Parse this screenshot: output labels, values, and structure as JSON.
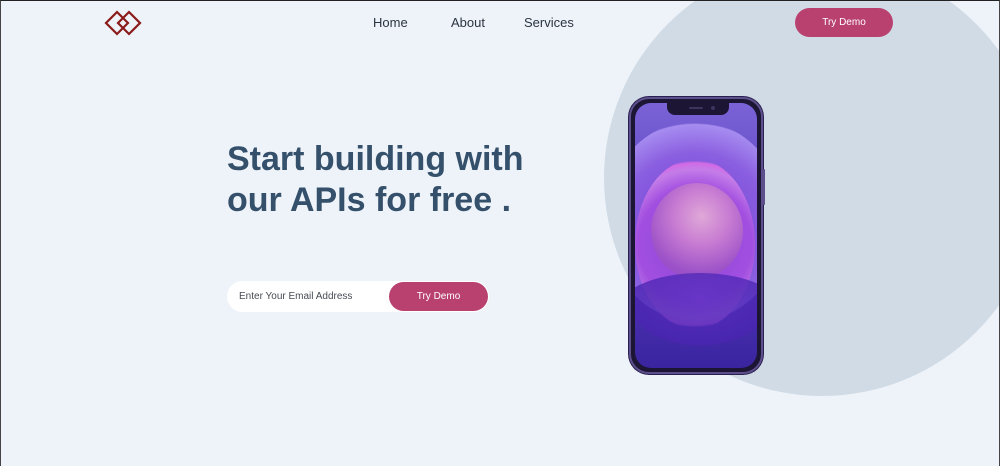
{
  "nav": {
    "links": [
      {
        "label": "Home"
      },
      {
        "label": "About"
      },
      {
        "label": "Services"
      }
    ],
    "cta_label": "Try Demo"
  },
  "hero": {
    "title": "Start building with our APIs for free .",
    "email_placeholder": "Enter Your Email Address",
    "submit_label": "Try Demo"
  },
  "theme": {
    "accent": "#b94170",
    "heading": "#34506b",
    "background": "#eef3f9",
    "circle": "#d1dbe5",
    "logo": "#8b1a1a"
  },
  "icons": {
    "logo": "interlocked-diamonds-logo",
    "phone": "smartphone-illustration"
  }
}
